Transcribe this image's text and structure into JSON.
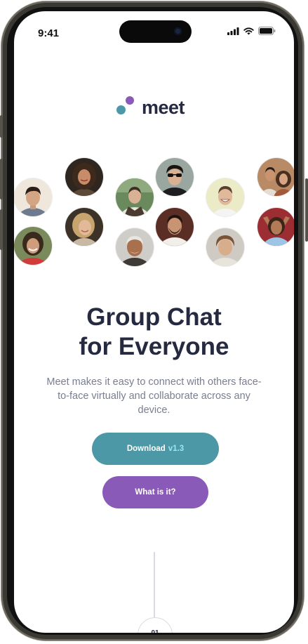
{
  "status_bar": {
    "time": "9:41"
  },
  "logo": {
    "text": "meet"
  },
  "hero": {
    "title_line1": "Group Chat",
    "title_line2": "for Everyone",
    "description": "Meet makes it easy to connect with others face-to-face virtually and collaborate across any device."
  },
  "buttons": {
    "download_label": "Download",
    "download_version": "v1.3",
    "what_label": "What is it?"
  },
  "scroll_indicator": {
    "label": "01"
  },
  "colors": {
    "teal": "#4d98a6",
    "purple": "#8a5ab8",
    "navy": "#262a40",
    "version_accent": "#9fe4ef"
  },
  "avatars": [
    {
      "name": "avatar-man-dark-hair"
    },
    {
      "name": "avatar-woman-curly-hair"
    },
    {
      "name": "avatar-man-outdoors"
    },
    {
      "name": "avatar-man-sunglasses"
    },
    {
      "name": "avatar-man-smiling-yellow"
    },
    {
      "name": "avatar-couple"
    },
    {
      "name": "avatar-man-long-hair"
    },
    {
      "name": "avatar-woman-blonde"
    },
    {
      "name": "avatar-older-man"
    },
    {
      "name": "avatar-man-beard"
    },
    {
      "name": "avatar-young-man"
    },
    {
      "name": "avatar-woman-blue-shirt"
    }
  ]
}
